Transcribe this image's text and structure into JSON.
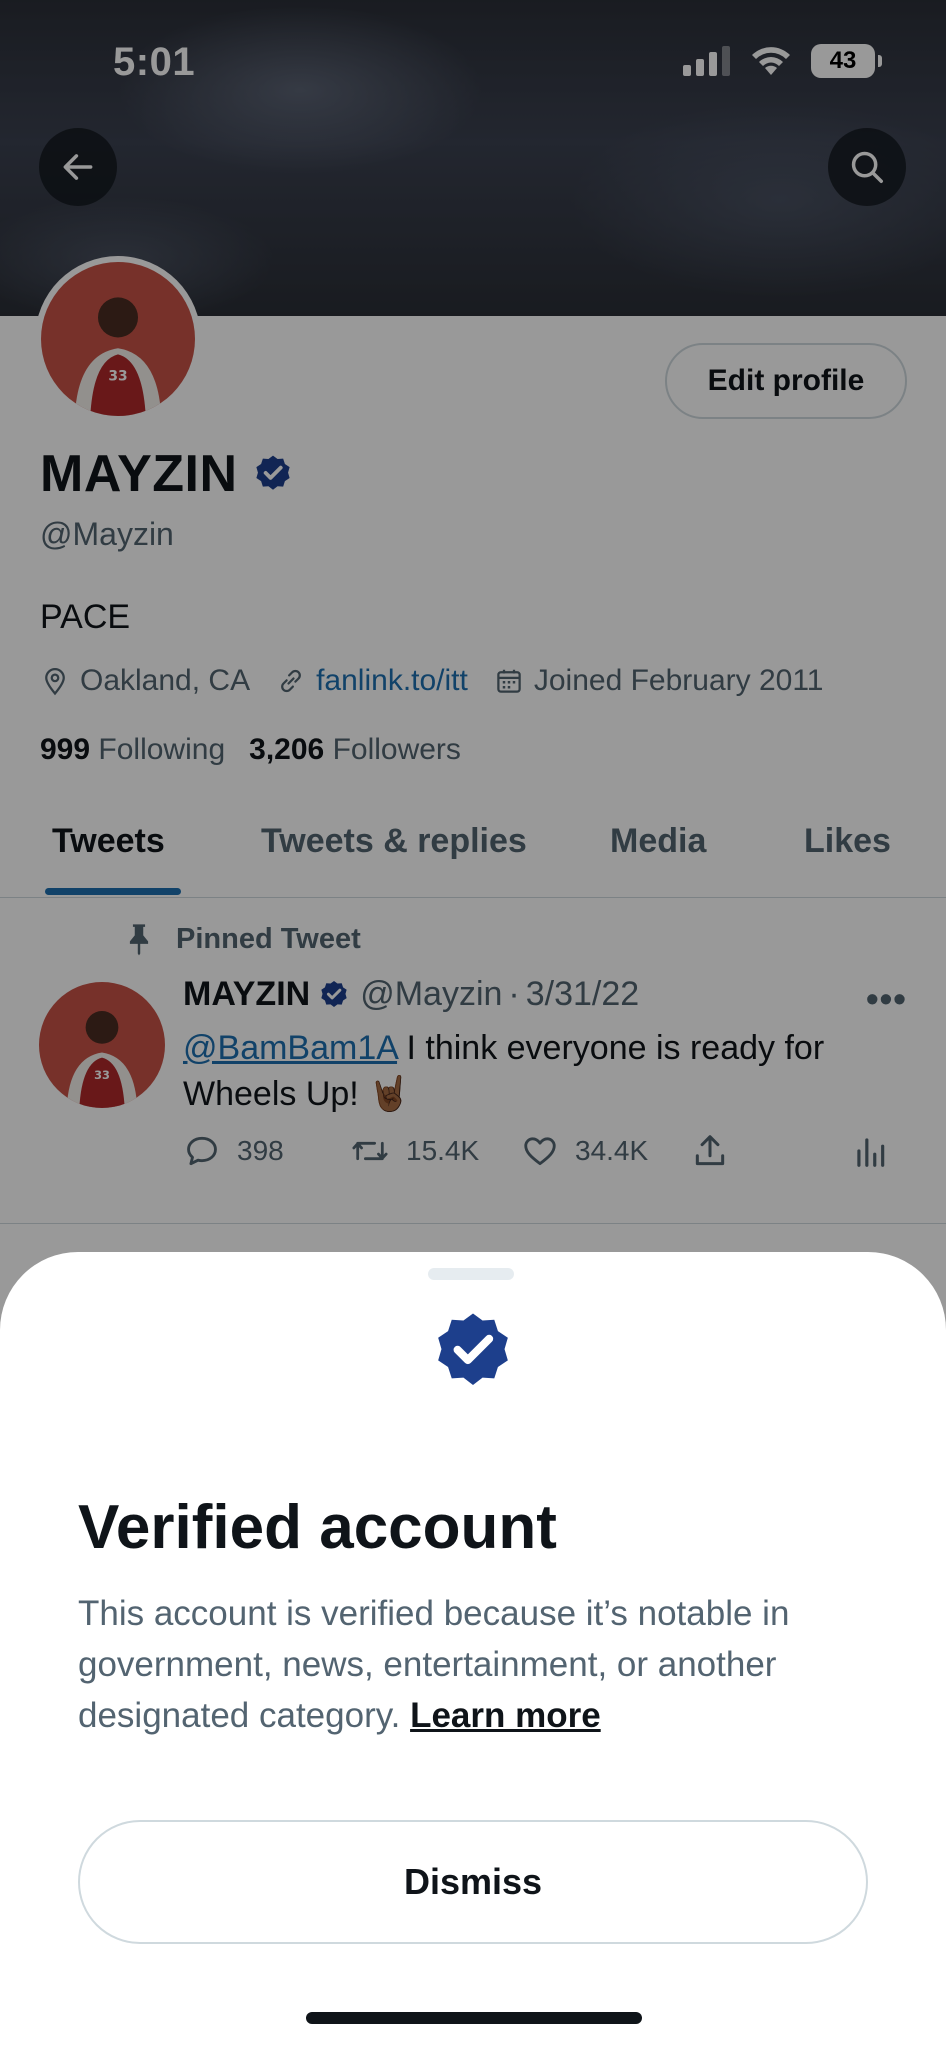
{
  "status_bar": {
    "time": "5:01",
    "battery": "43"
  },
  "profile": {
    "edit_profile_label": "Edit profile",
    "name": "MAYZIN",
    "handle": "@Mayzin",
    "bio": "PACE",
    "location": "Oakland, CA",
    "website": "fanlink.to/itt",
    "joined": "Joined February 2011",
    "following_count": "999",
    "following_label": "Following",
    "followers_count": "3,206",
    "followers_label": "Followers"
  },
  "tabs": [
    {
      "label": "Tweets",
      "active": true
    },
    {
      "label": "Tweets & replies",
      "active": false
    },
    {
      "label": "Media",
      "active": false
    },
    {
      "label": "Likes",
      "active": false
    }
  ],
  "pinned_tweet": {
    "pinned_label": "Pinned Tweet",
    "author_name": "MAYZIN",
    "author_handle": "@Mayzin",
    "separator": "·",
    "date": "3/31/22",
    "mention": "@BamBam1A",
    "text": " I think everyone is ready for Wheels Up! 🤘🏾",
    "replies": "398",
    "retweets": "15.4K",
    "likes": "34.4K"
  },
  "sheet": {
    "title": "Verified account",
    "body": "This account is verified because it’s notable in government, news, entertainment, or another designated category. ",
    "learn_more": "Learn more",
    "dismiss_label": "Dismiss"
  },
  "colors": {
    "verified_blue": "#1d3f8c",
    "link_blue": "#1d6fb0",
    "text_primary": "#0f1419",
    "text_secondary": "#536471",
    "border": "#cfd9de"
  }
}
